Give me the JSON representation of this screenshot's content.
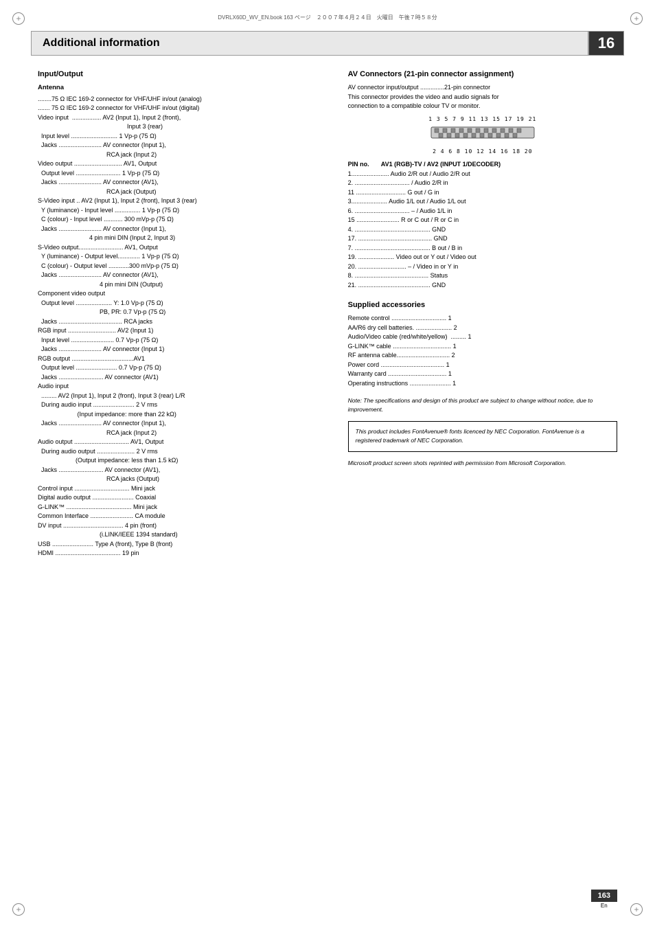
{
  "page": {
    "chapter_number": "16",
    "page_number": "163",
    "page_lang": "En",
    "file_info": "DVRLX60D_WV_EN.book  163 ページ　２００７年４月２４日　火曜日　午後７時５８分",
    "header_title": "Additional information"
  },
  "input_output": {
    "section_title": "Input/Output",
    "antenna_label": "Antenna",
    "lines": [
      "........75 Ω IEC 169-2 connector for VHF/UHF in/out (analog)",
      "....... 75 Ω IEC 169-2 connector for VHF/UHF in/out (digital)",
      "Video input  ................. AV2 (Input 1), Input 2 (front),",
      "                                                    Input 3 (rear)",
      "  Input level ........................... 1 Vp-p (75 Ω)",
      "  Jacks ......................... AV connector (Input 1),",
      "                                        RCA jack (Input 2)",
      "Video output ............................ AV1, Output",
      "  Output level .......................... 1 Vp-p (75 Ω)",
      "  Jacks ......................... AV connector (AV1),",
      "                                        RCA jack (Output)",
      "S-Video input .. AV2 (Input 1), Input 2 (front), Input 3 (rear)",
      "  Y (luminance) - Input level ............... 1 Vp-p (75 Ω)",
      "  C (colour) - Input level ........... 300 mVp-p (75 Ω)",
      "  Jacks ......................... AV connector (Input 1),",
      "                              4 pin mini DIN (Input 2, Input 3)",
      "S-Video output.......................... AV1, Output",
      "  Y (luminance) - Output level............. 1 Vp-p (75 Ω)",
      "  C (colour) - Output level ............300 mVp-p (75 Ω)",
      "  Jacks ......................... AV connector (AV1),",
      "                                    4 pin mini DIN (Output)",
      "Component video output",
      "  Output level ..................... Y: 1.0 Vp-p (75 Ω)",
      "                                    PB, PR: 0.7 Vp-p (75 Ω)",
      "  Jacks ..................................... RCA jacks",
      "RGB input ............................ AV2 (Input 1)",
      "  Input level ......................... 0.7 Vp-p (75 Ω)",
      "  Jacks ......................... AV connector (Input 1)",
      "RGB output ....................................AV1",
      "  Output level ........................ 0.7 Vp-p (75 Ω)",
      "  Jacks .......................... AV connector (AV1)",
      "Audio input",
      "  ......... AV2 (Input 1), Input 2 (front), Input 3 (rear) L/R",
      "  During audio input ........................ 2 V rms",
      "                       (Input impedance: more than 22 kΩ)",
      "  Jacks ......................... AV connector (Input 1),",
      "                                        RCA jack (Input 2)",
      "Audio output ................................ AV1, Output",
      "  During audio output ...................... 2 V rms",
      "                      (Output impedance: less than 1.5 kΩ)",
      "  Jacks .......................... AV connector (AV1),",
      "                                        RCA jacks (Output)",
      "Control input ................................ Mini jack",
      "Digital audio output ........................ Coaxial",
      "G-LINK™ ...................................... Mini jack",
      "Common Interface ......................... CA module",
      "DV input ................................... 4 pin (front)",
      "                                    (i.LINK/IEEE 1394 standard)",
      "USB ........................ Type A (front), Type B (front)",
      "HDMI ...................................... 19 pin"
    ]
  },
  "av_connectors": {
    "section_title": "AV Connectors (21-pin connector assignment)",
    "intro_line1": "AV connector input/output ..............21-pin connector",
    "intro_line2": "This connector provides the video and audio signals for",
    "intro_line3": "connection to a compatible colour TV or monitor.",
    "pin_top_numbers": "1 3 5 7 9  11 13 15 17 19 21",
    "pin_bottom_numbers": "2 4 6 8 10 12 14 16 18 20",
    "pin_header": "PIN no.       AV1 (RGB)-TV / AV2 (INPUT 1/DECODER)",
    "pin_list": [
      "1...................... Audio 2/R out / Audio 2/R out",
      "2. ................................ / Audio 2/R in",
      "11 ............................. G out / G in",
      "3..................... Audio 1/L out / Audio 1/L out",
      "6. ................................ – / Audio 1/L in",
      "15 ......................... R or C out / R or C in",
      "4. ............................................ GND",
      "17. ........................................... GND",
      "7. ............................................ B out / B in",
      "19. ..................... Video out or Y out / Video out",
      "20. ............................ – / Video in or Y in",
      "8. ........................................... Status",
      "21. .......................................... GND"
    ]
  },
  "supplied_accessories": {
    "section_title": "Supplied accessories",
    "items": [
      "Remote control ................................ 1",
      "AA/R6 dry cell batteries. ..................... 2",
      "Audio/Video cable (red/white/yellow)  ......... 1",
      "G-LINK™ cable .................................. 1",
      "RF antenna cable............................... 2",
      "Power cord ..................................... 1",
      "Warranty card .................................. 1",
      "Operating instructions ........................ 1"
    ]
  },
  "note": {
    "text": "Note: The specifications and design of this product are subject to change without notice, due to improvement."
  },
  "notice_box": {
    "text": "This product includes FontAvenue® fonts licenced by NEC Corporation. FontAvenue is a registered trademark of NEC Corporation."
  },
  "microsoft_note": {
    "text": "Microsoft product screen shots reprinted with permission from Microsoft Corporation."
  }
}
